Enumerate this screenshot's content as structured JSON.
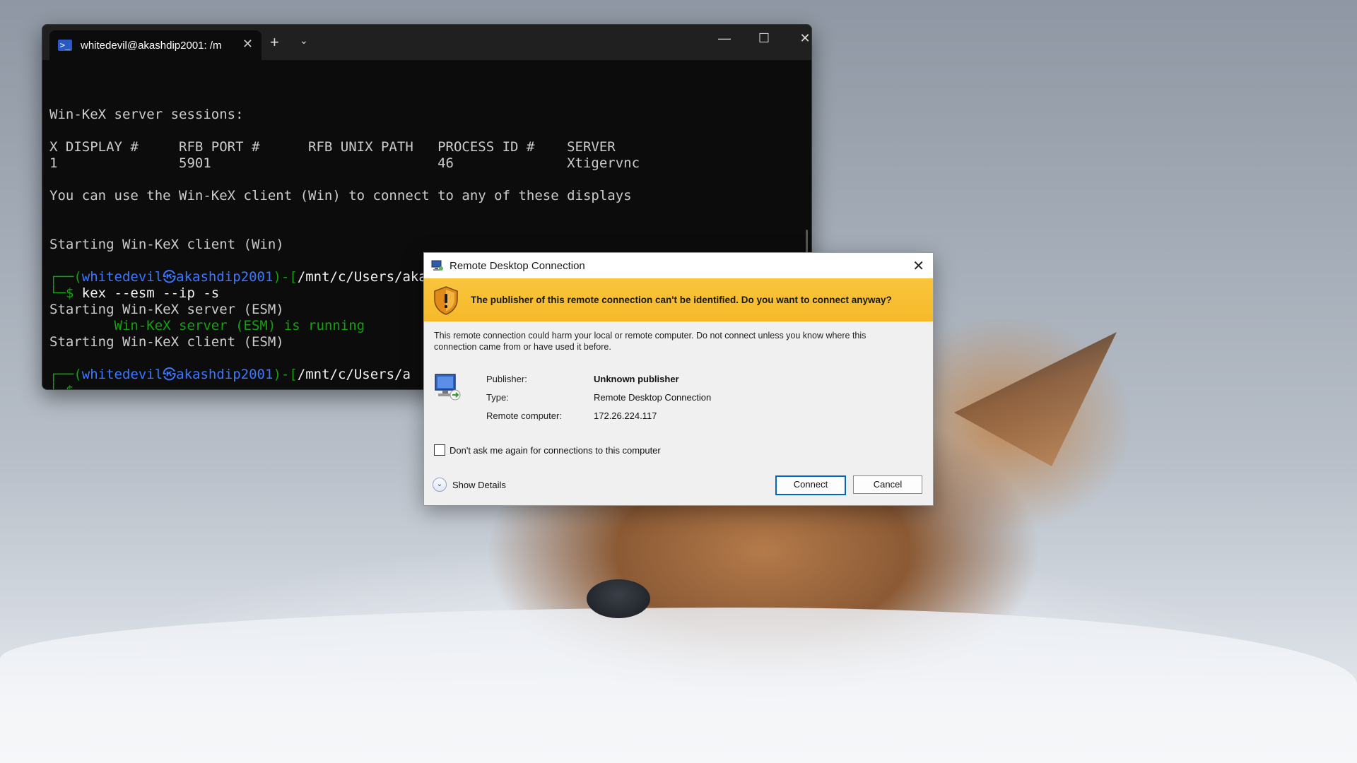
{
  "terminal": {
    "tab_title": "whitedevil@akashdip2001: /m",
    "lines": {
      "sessions_header": "Win-KeX server sessions:",
      "table_header": "X DISPLAY #     RFB PORT #      RFB UNIX PATH   PROCESS ID #    SERVER",
      "table_row": "1               5901                            46              Xtigervnc",
      "info": "You can use the Win-KeX client (Win) to connect to any of these displays",
      "starting_client_win": "Starting Win-KeX client (Win)",
      "prompt1_open": "┌──(",
      "prompt1_user": "whitedevil㉿akashdip2001",
      "prompt1_sep": ")-[",
      "prompt1_path": "/mnt/c/Users/akash",
      "prompt1_close": "]",
      "cmd_dollar": "└─$",
      "cmd_text": " kex --esm --ip -s",
      "starting_server_esm": "Starting Win-KeX server (ESM)",
      "server_running": "        Win-KeX server (ESM) is running",
      "starting_client_esm": "Starting Win-KeX client (ESM)",
      "prompt2_open": "┌──(",
      "prompt2_user": "whitedevil㉿akashdip2001",
      "prompt2_sep": ")-[",
      "prompt2_path": "/mnt/c/Users/a",
      "prompt2_dollar": "└─$"
    }
  },
  "dialog": {
    "title": "Remote Desktop Connection",
    "warning": "The publisher of this remote connection can't be identified. Do you want to connect anyway?",
    "description": "This remote connection could harm your local or remote computer. Do not connect unless you know where this connection came from or have used it before.",
    "publisher_label": "Publisher:",
    "publisher_value": "Unknown publisher",
    "type_label": "Type:",
    "type_value": "Remote Desktop Connection",
    "remote_label": "Remote computer:",
    "remote_value": "172.26.224.117",
    "checkbox_label": "Don't ask me again for connections to this computer",
    "show_details": "Show Details",
    "connect": "Connect",
    "cancel": "Cancel"
  },
  "icons": [
    "powershell-icon",
    "close-icon",
    "plus-icon",
    "chevron-down-icon",
    "minimize-icon",
    "maximize-icon",
    "rdp-app-icon",
    "shield-warning-icon",
    "computer-icon",
    "expand-icon"
  ],
  "colors": {
    "term_green": "#13a10e",
    "term_blue": "#3b78ff",
    "warning_band": "#f6b92a",
    "button_focus": "#0067c0"
  }
}
